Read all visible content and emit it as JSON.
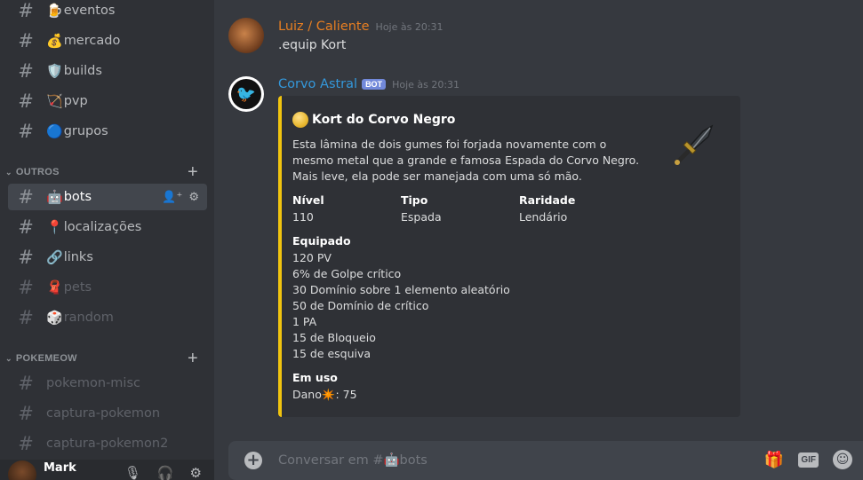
{
  "sidebar": {
    "channels": [
      {
        "emoji": "🍺",
        "name": "eventos"
      },
      {
        "emoji": "💰",
        "name": "mercado"
      },
      {
        "emoji": "🛡️",
        "name": "builds"
      },
      {
        "emoji": "🏹",
        "name": "pvp"
      },
      {
        "emoji": "🔵",
        "name": "grupos"
      }
    ],
    "category_outros": "OUTROS",
    "outros_channels": [
      {
        "emoji": "🤖",
        "name": "bots"
      },
      {
        "emoji": "📍",
        "name": "localizações"
      },
      {
        "emoji": "🔗",
        "name": "links"
      },
      {
        "emoji": "🧣",
        "name": "pets"
      },
      {
        "emoji": "🎲",
        "name": "random"
      }
    ],
    "category_pokemeow": "POKEMEOW",
    "pokemeow_channels": [
      {
        "name": "pokemon-misc"
      },
      {
        "name": "captura-pokemon"
      },
      {
        "name": "captura-pokemon2"
      }
    ],
    "user": {
      "name": "Mark"
    }
  },
  "messages": [
    {
      "author": "Luiz / Caliente",
      "timestamp": "Hoje às 20:31",
      "text": ".equip Kort"
    },
    {
      "author": "Corvo Astral",
      "bot_tag": "BOT",
      "timestamp": "Hoje às 20:31"
    }
  ],
  "embed": {
    "title": "Kort do Corvo Negro",
    "description": "Esta lâmina de dois gumes foi forjada novamente com o mesmo metal que a grande e famosa Espada do Corvo Negro. Mais leve, ela pode ser manejada com uma só mão.",
    "fields": {
      "nivel_name": "Nível",
      "nivel_value": "110",
      "tipo_name": "Tipo",
      "tipo_value": "Espada",
      "raridade_name": "Raridade",
      "raridade_value": "Lendário"
    },
    "equipado_name": "Equipado",
    "equipado_lines": [
      "120 PV",
      "6% de Golpe crítico",
      "30 Domínio sobre 1 elemento aleatório",
      "50 de Domínio de crítico",
      "1 PA",
      "15 de Bloqueio",
      "15 de esquiva"
    ],
    "em_uso_name": "Em uso",
    "em_uso_prefix": "Dano",
    "em_uso_emoji": "✴️",
    "em_uso_value": ": 75",
    "accent_color": "#f1c40f"
  },
  "input": {
    "placeholder_prefix": "Conversar em #",
    "placeholder_emoji": "🤖",
    "placeholder_channel": "bots",
    "gif_label": "GIF"
  }
}
